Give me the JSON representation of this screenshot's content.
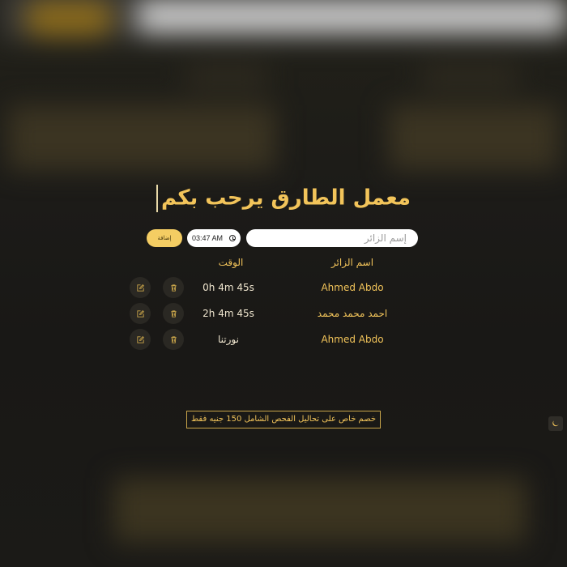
{
  "header": {
    "title": "معمل الطارق يرحب بكم"
  },
  "form": {
    "name_placeholder": "إسم الزائر",
    "time_value": "03:47 AM",
    "add_label": "إضافة"
  },
  "table": {
    "columns": {
      "name": "اسم الزائر",
      "time": "الوقت"
    },
    "rows": [
      {
        "name": "Ahmed Abdo",
        "time": "0h 4m 45s"
      },
      {
        "name": "احمد محمد محمد",
        "time": "2h 4m 45s"
      },
      {
        "name": "Ahmed Abdo",
        "time": "نورتنا"
      }
    ]
  },
  "promo": {
    "text": "خصم خاص على تحاليل الفحص الشامل 150 جنيه فقط"
  },
  "icons": {
    "delete": "trash-icon",
    "edit": "edit-icon",
    "clock": "clock-icon",
    "theme": "moon-icon"
  },
  "colors": {
    "accent": "#f2c45a",
    "background": "#1b1a17",
    "button": "#f4cd63"
  }
}
